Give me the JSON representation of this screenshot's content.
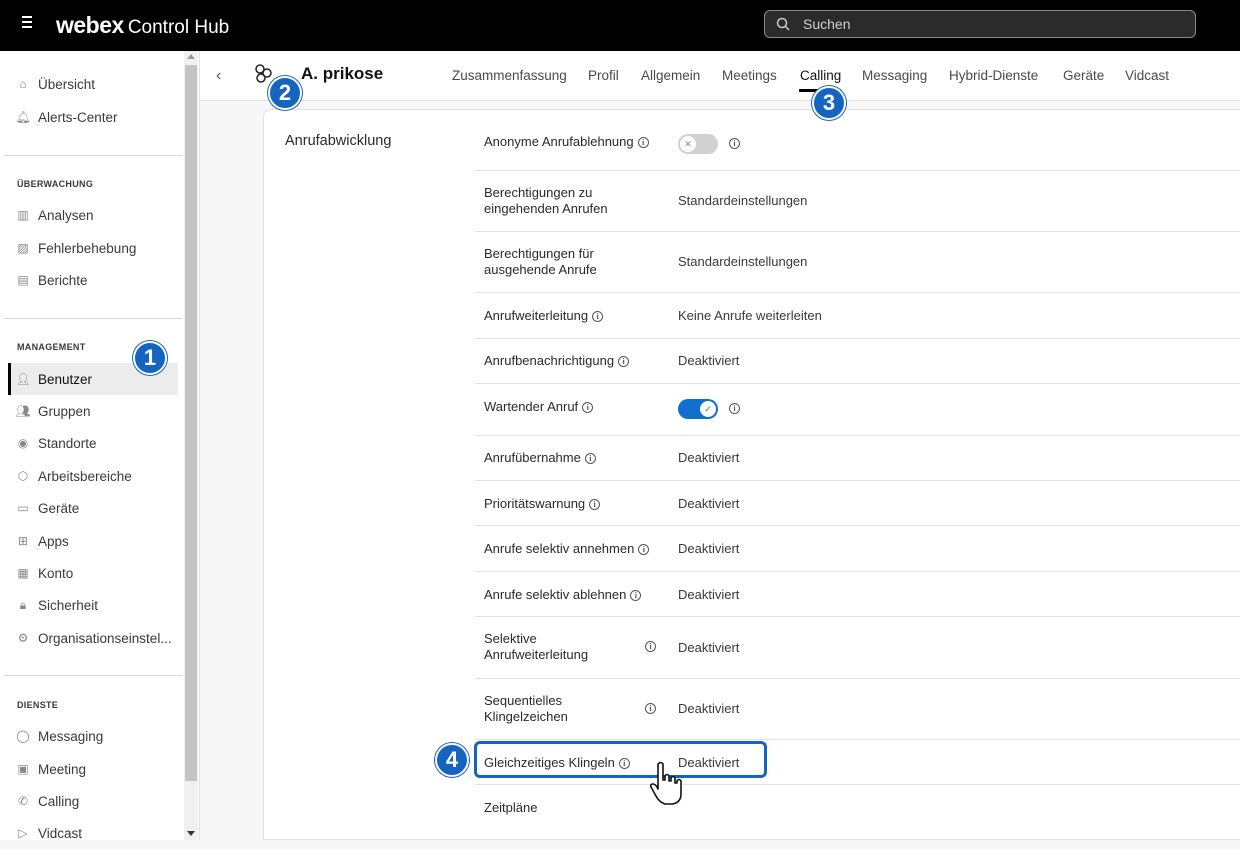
{
  "topbar": {
    "brand_bold": "webex",
    "brand_rest": "Control Hub",
    "search_placeholder": "Suchen"
  },
  "sidebar": {
    "top_items": [
      {
        "label": "Übersicht",
        "icon": "home-icon"
      },
      {
        "label": "Alerts-Center",
        "icon": "bell-icon"
      }
    ],
    "sections": [
      {
        "title": "ÜBERWACHUNG",
        "items": [
          {
            "label": "Analysen",
            "icon": "chart-icon"
          },
          {
            "label": "Fehlerbehebung",
            "icon": "troubleshoot-icon"
          },
          {
            "label": "Berichte",
            "icon": "report-icon"
          }
        ]
      },
      {
        "title": "MANAGEMENT",
        "items": [
          {
            "label": "Benutzer",
            "icon": "user-icon",
            "active": true
          },
          {
            "label": "Gruppen",
            "icon": "group-icon"
          },
          {
            "label": "Standorte",
            "icon": "location-icon"
          },
          {
            "label": "Arbeitsbereiche",
            "icon": "workspace-icon"
          },
          {
            "label": "Geräte",
            "icon": "device-icon"
          },
          {
            "label": "Apps",
            "icon": "apps-icon"
          },
          {
            "label": "Konto",
            "icon": "account-icon"
          },
          {
            "label": "Sicherheit",
            "icon": "lock-icon"
          },
          {
            "label": "Organisationseinstel...",
            "icon": "gear-icon"
          }
        ]
      },
      {
        "title": "DIENSTE",
        "items": [
          {
            "label": "Messaging",
            "icon": "message-icon"
          },
          {
            "label": "Meeting",
            "icon": "calendar-icon"
          },
          {
            "label": "Calling",
            "icon": "phone-icon"
          },
          {
            "label": "Vidcast",
            "icon": "play-icon"
          }
        ]
      }
    ]
  },
  "badges": [
    "1",
    "2",
    "3",
    "4"
  ],
  "header": {
    "user_name": "A. prikose",
    "tabs": [
      "Zusammenfassung",
      "Profil",
      "Allgemein",
      "Meetings",
      "Calling",
      "Messaging",
      "Hybrid-Dienste",
      "Geräte",
      "Vidcast"
    ],
    "active_tab": "Calling"
  },
  "section_title": "Anrufabwicklung",
  "settings": [
    {
      "label": "Anonyme Anrufablehnung",
      "type": "toggle",
      "state": "off"
    },
    {
      "label": "Berechtigungen zu eingehenden Anrufen",
      "value": "Standardeinstellungen"
    },
    {
      "label": "Berechtigungen für ausgehende Anrufe",
      "value": "Standardeinstellungen"
    },
    {
      "label": "Anrufweiterleitung",
      "value": "Keine Anrufe weiterleiten"
    },
    {
      "label": "Anrufbenachrichtigung",
      "value": "Deaktiviert"
    },
    {
      "label": "Wartender Anruf",
      "type": "toggle",
      "state": "on"
    },
    {
      "label": "Anrufübernahme",
      "value": "Deaktiviert"
    },
    {
      "label": "Prioritätswarnung",
      "value": "Deaktiviert"
    },
    {
      "label": "Anrufe selektiv annehmen",
      "value": "Deaktiviert"
    },
    {
      "label": "Anrufe selektiv ablehnen",
      "value": "Deaktiviert"
    },
    {
      "label": "Selektive Anrufweiterleitung",
      "value": "Deaktiviert"
    },
    {
      "label": "Sequentielles Klingelzeichen",
      "value": "Deaktiviert"
    },
    {
      "label": "Gleichzeitiges Klingeln",
      "value": "Deaktiviert",
      "highlighted": true
    },
    {
      "label": "Zeitpläne"
    }
  ],
  "colors": {
    "accent": "#1170cf",
    "badge": "#1565c0",
    "topbar": "#000000"
  }
}
